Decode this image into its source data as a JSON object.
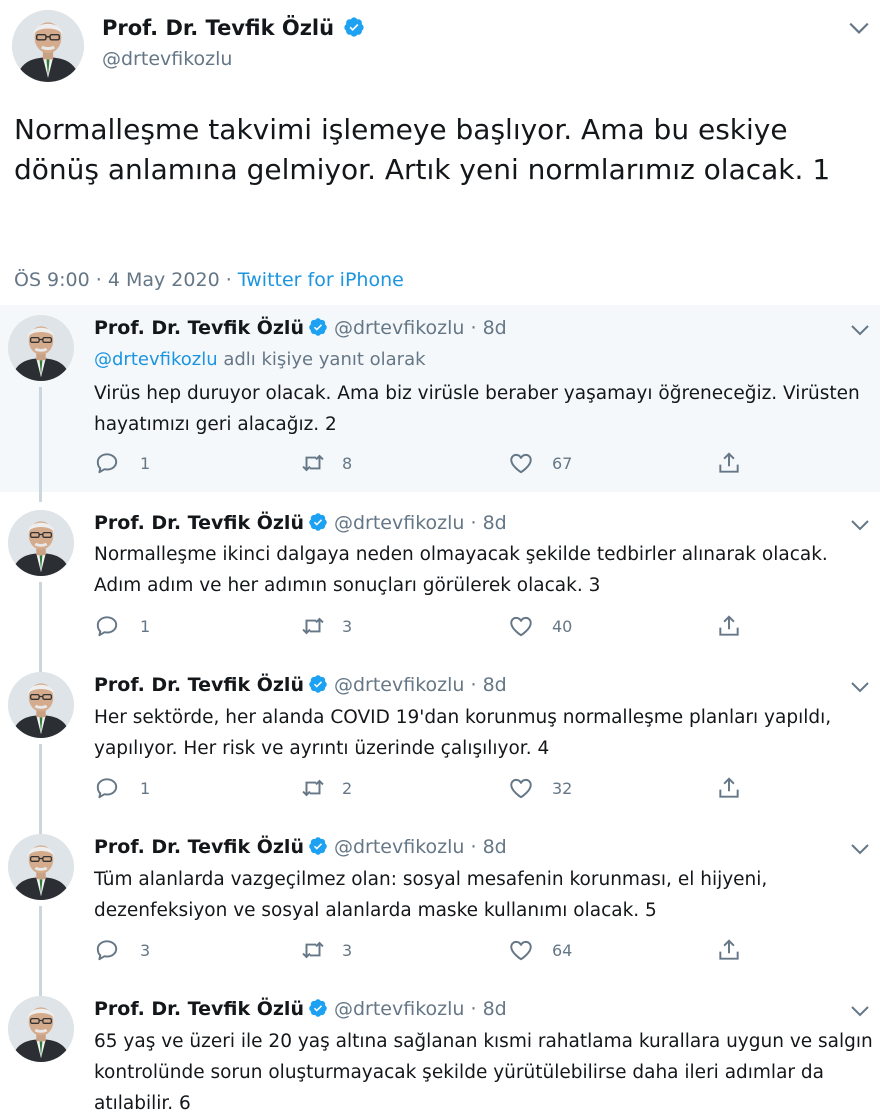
{
  "main_tweet": {
    "author_name": "Prof. Dr. Tevfik Özlü",
    "author_handle": "@drtevfikozlu",
    "text": "Normalleşme takvimi işlemeye başlıyor. Ama bu eskiye dönüş anlamına gelmiyor. Artık yeni normlarımız olacak. 1",
    "time": "ÖS 9:00",
    "date": "4 May 2020",
    "separator": " · ",
    "source": "Twitter for iPhone"
  },
  "reply_to": {
    "handle": "@drtevfikozlu",
    "suffix": " adlı kişiye yanıt olarak"
  },
  "replies": [
    {
      "author_name": "Prof. Dr. Tevfik Özlü",
      "author_handle": "@drtevfikozlu",
      "time_ago": "8d",
      "text": "Virüs hep duruyor olacak. Ama biz virüsle beraber yaşamayı öğreneceğiz. Virüsten hayatımızı geri alacağız. 2",
      "replies": "1",
      "retweets": "8",
      "likes": "67"
    },
    {
      "author_name": "Prof. Dr. Tevfik Özlü",
      "author_handle": "@drtevfikozlu",
      "time_ago": "8d",
      "text": "Normalleşme ikinci dalgaya neden olmayacak şekilde tedbirler alınarak olacak. Adım adım ve her adımın sonuçları görülerek olacak. 3",
      "replies": "1",
      "retweets": "3",
      "likes": "40"
    },
    {
      "author_name": "Prof. Dr. Tevfik Özlü",
      "author_handle": "@drtevfikozlu",
      "time_ago": "8d",
      "text": "Her sektörde, her alanda COVID 19'dan korunmuş normalleşme planları yapıldı, yapılıyor. Her risk ve ayrıntı üzerinde çalışılıyor. 4",
      "replies": "1",
      "retweets": "2",
      "likes": "32"
    },
    {
      "author_name": "Prof. Dr. Tevfik Özlü",
      "author_handle": "@drtevfikozlu",
      "time_ago": "8d",
      "text": "Tüm alanlarda vazgeçilmez olan: sosyal mesafenin korunması, el hijyeni, dezenfeksiyon ve sosyal alanlarda maske kullanımı olacak. 5",
      "replies": "3",
      "retweets": "3",
      "likes": "64"
    },
    {
      "author_name": "Prof. Dr. Tevfik Özlü",
      "author_handle": "@drtevfikozlu",
      "time_ago": "8d",
      "text": "65 yaş ve üzeri ile 20 yaş altına sağlanan kısmi rahatlama kurallara uygun ve salgın kontrolünde sorun oluşturmayacak şekilde yürütülebilirse daha ileri adımlar da atılabilir. 6"
    }
  ],
  "colors": {
    "link": "#1b95e0",
    "secondary_text": "#657786",
    "verified": "#1da1f2",
    "thread_line": "#ccd6dd",
    "highlight_bg": "#f5f8fa"
  },
  "icons": [
    "verified-badge-icon",
    "chevron-down-icon",
    "reply-icon",
    "retweet-icon",
    "like-icon",
    "share-icon"
  ]
}
